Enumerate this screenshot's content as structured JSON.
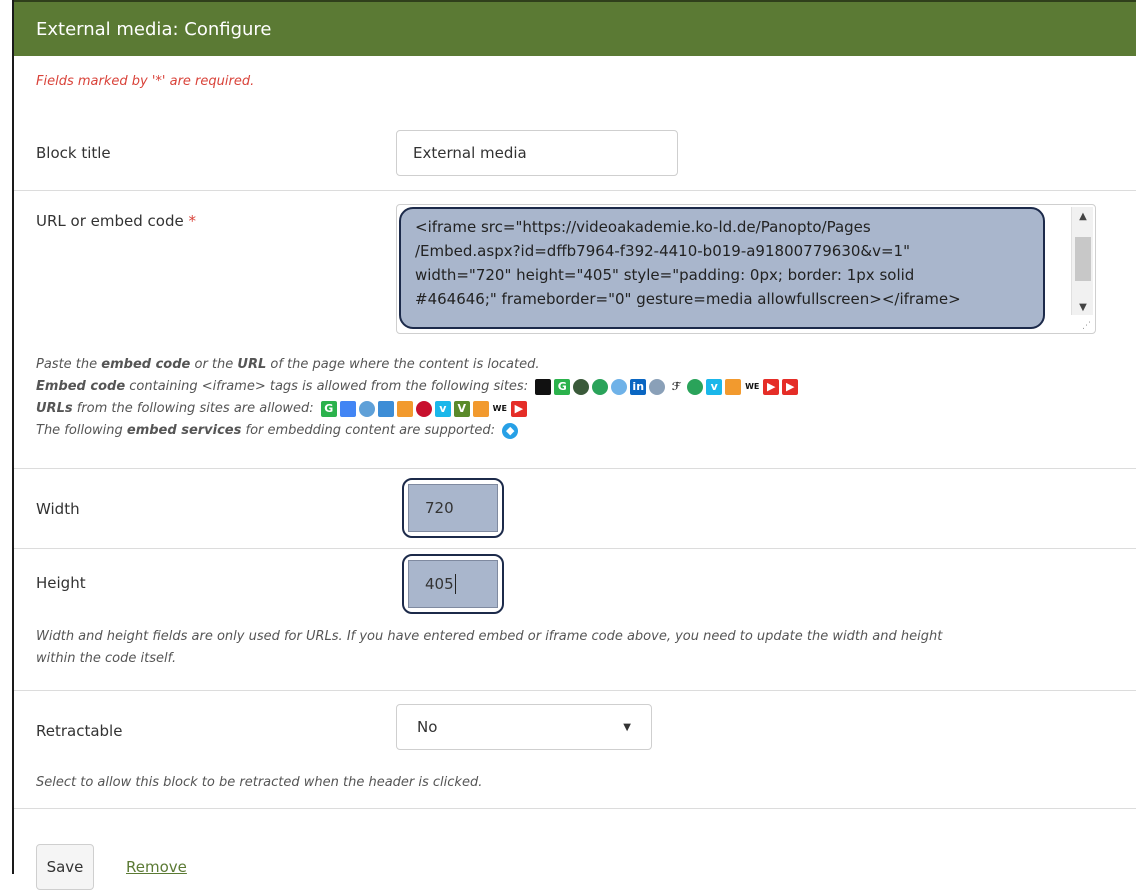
{
  "header": {
    "title": "External media: Configure"
  },
  "form": {
    "required_note": "Fields marked by '*' are required.",
    "block_title": {
      "label": "Block title",
      "value": "External media"
    },
    "url": {
      "label": "URL or embed code",
      "required_mark": "*",
      "value": "<iframe src=\"https://videoakademie.ko-ld.de/Panopto/Pages\n/Embed.aspx?id=dffb7964-f392-4410-b019-a91800779630&v=1\"\nwidth=\"720\" height=\"405\" style=\"padding: 0px; border: 1px solid\n#464646;\" frameborder=\"0\" gesture=media allowfullscreen></iframe>",
      "help": {
        "line1_a": "Paste the ",
        "line1_b": "embed code",
        "line1_c": " or the ",
        "line1_d": "URL",
        "line1_e": " of the page where the content is located.",
        "line2_a": "Embed code",
        "line2_b": " containing <iframe> tags is allowed from the following sites:",
        "line3_a": "URLs",
        "line3_b": " from the following sites are allowed:",
        "line4_a": "The following ",
        "line4_b": "embed services",
        "line4_c": " for embedding content are supported:"
      }
    },
    "width": {
      "label": "Width",
      "value": "720"
    },
    "height": {
      "label": "Height",
      "value": "405"
    },
    "size_help": "Width and height fields are only used for URLs. If you have entered embed or iframe code above, you need to update the width and height\nwithin the code itself.",
    "retractable": {
      "label": "Retractable",
      "value": "No",
      "help": "Select to allow this block to be retracted when the header is clicked."
    },
    "save_label": "Save",
    "remove_label": "Remove"
  },
  "icons": {
    "embed_sites": [
      "prezi-icon",
      "glogster-icon",
      "voki-icon",
      "slideshare-icon",
      "wikieducator-icon",
      "linkedin-icon",
      "globe-icon",
      "scribd-icon",
      "slideshare-icon",
      "vimeo-icon",
      "teachertube-icon",
      "we-icon",
      "youtube-icon",
      "youtube-icon"
    ],
    "url_sites": [
      "glogster-icon",
      "google-icon",
      "circle-icon",
      "scratch-icon",
      "teachertube-icon",
      "apple-icon",
      "vimeo-icon",
      "voki-icon",
      "teachertube-icon",
      "we-icon",
      "youtube-icon"
    ],
    "embed_services": [
      "embedly-icon"
    ]
  },
  "colors": {
    "header_bg": "#5b7a34",
    "required": "#d9433a",
    "highlight": "#a9b6cc",
    "link": "#5b7a34"
  }
}
